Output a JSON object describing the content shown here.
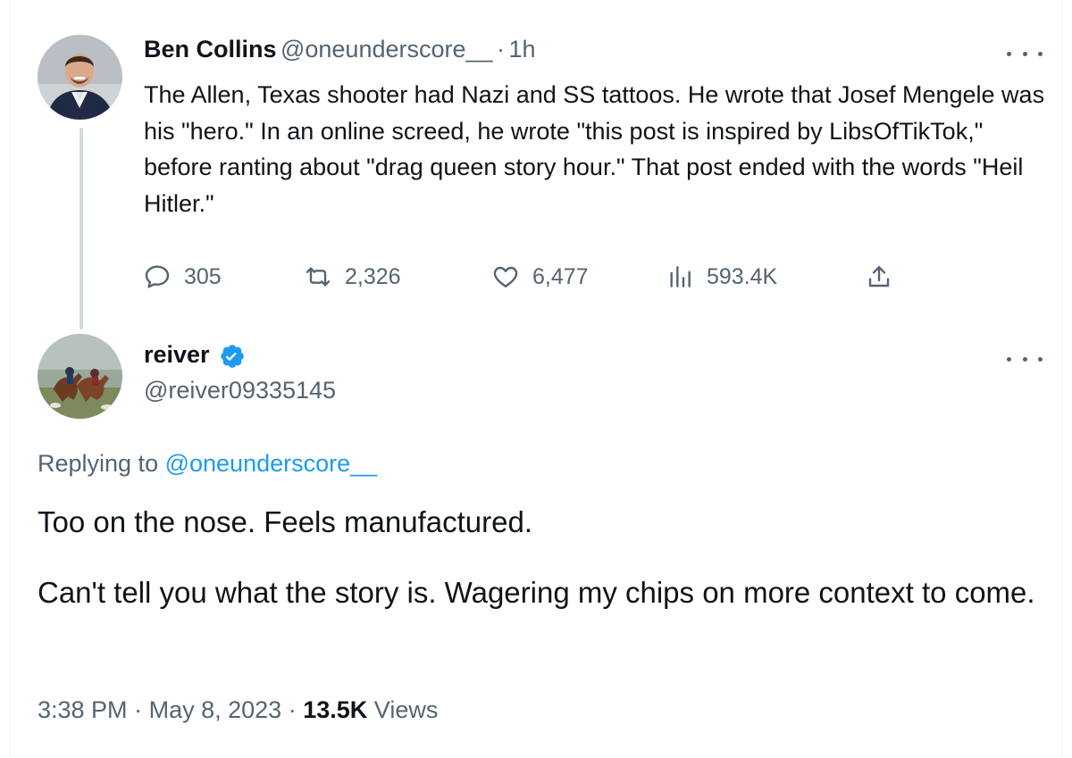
{
  "original_tweet": {
    "author_name": "Ben Collins",
    "author_handle": "@oneunderscore__",
    "separator": "·",
    "time_ago": "1h",
    "text": "The Allen, Texas shooter had Nazi and SS tattoos. He wrote that Josef Mengele was his \"hero.\" In an online screed, he wrote \"this post is inspired by LibsOfTikTok,\" before ranting about \"drag queen story hour.\" That post ended with the words \"Heil Hitler.\"",
    "replies": "305",
    "retweets": "2,326",
    "likes": "6,477",
    "views": "593.4K"
  },
  "reply_tweet": {
    "author_name": "reiver",
    "author_handle": "@reiver09335145",
    "replying_prefix": "Replying to ",
    "replying_to": "@oneunderscore__",
    "text_paragraph_1": "Too on the nose. Feels manufactured.",
    "text_paragraph_2": "Can't tell you what the story is. Wagering my chips on more context to come.",
    "time": "3:38 PM",
    "date": "May 8, 2023",
    "views_count": "13.5K",
    "views_label": "Views"
  },
  "colors": {
    "text_primary": "#0f1419",
    "text_secondary": "#536471",
    "accent": "#1d9bf0",
    "thread_line": "#cfd9de"
  }
}
